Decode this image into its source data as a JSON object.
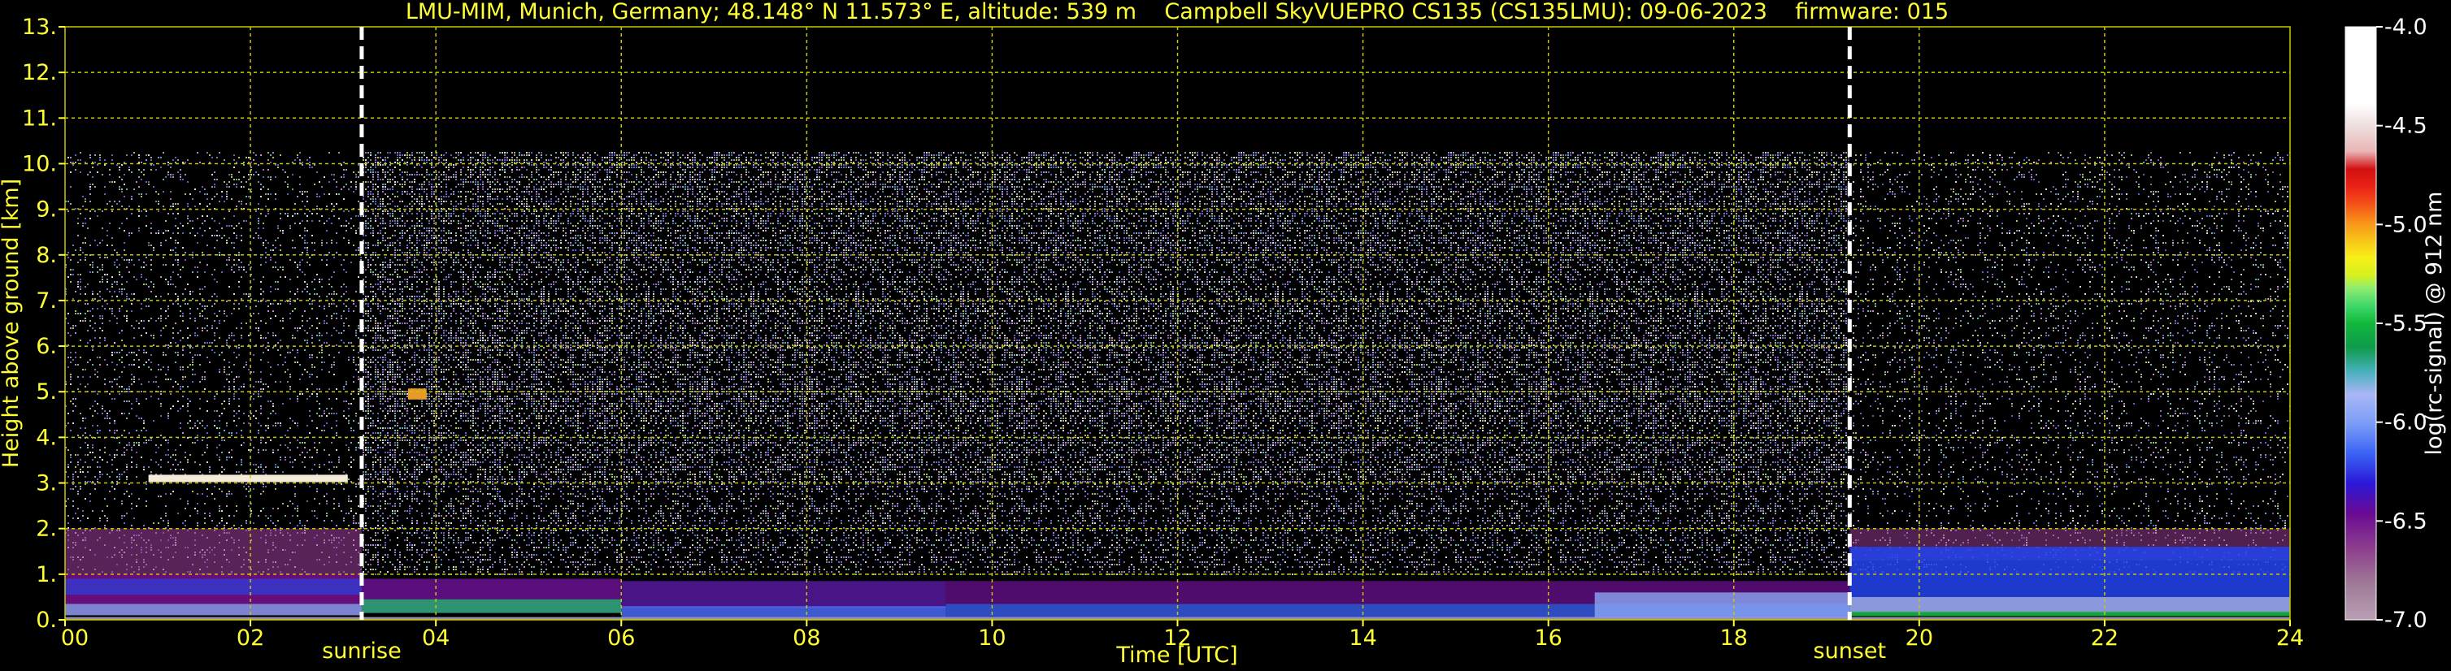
{
  "chart_data": {
    "type": "heatmap",
    "title": "LMU-MIM, Munich, Germany; 48.148° N 11.573° E, altitude: 539 m    Campbell SkyVUEPRO CS135 (CS135LMU): 09-06-2023    firmware: 015",
    "xlabel": "Time [UTC]",
    "ylabel": "Height above ground [km]",
    "xlim": [
      0,
      24
    ],
    "ylim": [
      0,
      13
    ],
    "x_ticks": [
      0,
      2,
      4,
      6,
      8,
      10,
      12,
      14,
      16,
      18,
      20,
      22,
      24
    ],
    "x_tick_labels": [
      "00",
      "02",
      "04",
      "06",
      "08",
      "10",
      "12",
      "14",
      "16",
      "18",
      "20",
      "22",
      "24"
    ],
    "y_ticks": [
      0,
      1,
      2,
      3,
      4,
      5,
      6,
      7,
      8,
      9,
      10,
      11,
      12,
      13
    ],
    "y_tick_labels": [
      "0.",
      "1.",
      "2.",
      "3.",
      "4.",
      "5.",
      "6.",
      "7.",
      "8.",
      "9.",
      "10.",
      "11.",
      "12.",
      "13."
    ],
    "grid": true,
    "max_signal_height_km": 10.25,
    "markers": [
      {
        "label": "sunrise",
        "time": 3.2
      },
      {
        "label": "sunset",
        "time": 19.25
      }
    ],
    "colorbar": {
      "label": "log(rc-signal) @ 912 nm",
      "range": [
        -7.0,
        -4.0
      ],
      "ticks": [
        -4.0,
        -4.5,
        -5.0,
        -5.5,
        -6.0,
        -6.5,
        -7.0
      ],
      "tick_labels": [
        "-4.0",
        "-4.5",
        "-5.0",
        "-5.5",
        "-6.0",
        "-6.5",
        "-7.0"
      ]
    },
    "features": [
      {
        "type": "cloud_layer",
        "time_start": 0.9,
        "time_end": 3.05,
        "height_km": 3.1
      },
      {
        "type": "cloud_patch",
        "time_start": 3.7,
        "time_end": 3.9,
        "height_km": 4.95
      },
      {
        "type": "boundary_layer",
        "time_start": 0,
        "time_end": 3.2,
        "top_km": 2.0
      },
      {
        "type": "boundary_layer",
        "time_start": 19.25,
        "time_end": 24,
        "top_km": 2.0
      }
    ]
  },
  "colors": {
    "text": "#ffff33",
    "grid": "#c8c800",
    "background": "#000000",
    "marker": "#ffffff"
  }
}
